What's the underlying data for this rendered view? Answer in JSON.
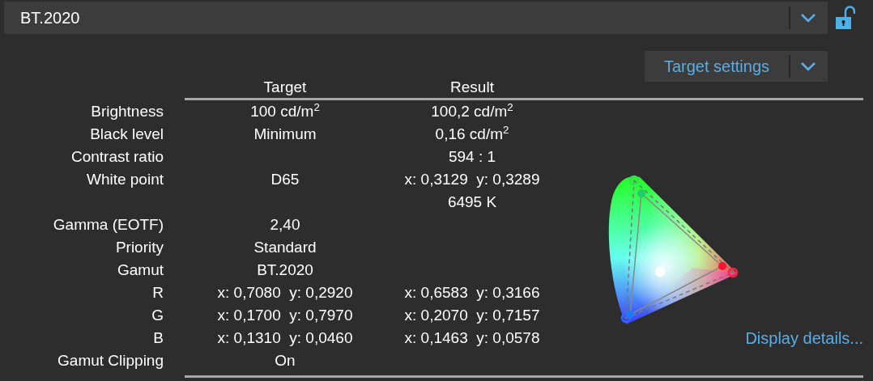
{
  "profile_select": {
    "value": "BT.2020",
    "locked": false
  },
  "target_settings_button": "Target settings",
  "table": {
    "columns": [
      "Target",
      "Result"
    ],
    "rows": [
      {
        "label": "Brightness",
        "target": "100 cd/m$^{2}$",
        "result": "100,2 cd/m$^{2}$"
      },
      {
        "label": "Black level",
        "target": "Minimum",
        "result": "0,16 cd/m$^{2}$"
      },
      {
        "label": "Contrast ratio",
        "target": "",
        "result": "594 : 1"
      },
      {
        "label": "White point",
        "target": "D65",
        "result": "x: 0,3129  y: 0,3289"
      },
      {
        "label": "",
        "target": "",
        "result": "6495 K"
      },
      {
        "label": "Gamma (EOTF)",
        "target": "2,40",
        "result": ""
      },
      {
        "label": "Priority",
        "target": "Standard",
        "result": ""
      },
      {
        "label": "Gamut",
        "target": "BT.2020",
        "result": ""
      },
      {
        "label": "R",
        "target": "x: 0,7080  y: 0,2920",
        "result": "x: 0,6583  y: 0,3166"
      },
      {
        "label": "G",
        "target": "x: 0,1700  y: 0,7970",
        "result": "x: 0,2070  y: 0,7157"
      },
      {
        "label": "B",
        "target": "x: 0,1310  y: 0,0460",
        "result": "x: 0,1463  y: 0,0578"
      },
      {
        "label": "Gamut Clipping",
        "target": "On",
        "result": ""
      }
    ]
  },
  "display_details_link": "Display details..."
}
